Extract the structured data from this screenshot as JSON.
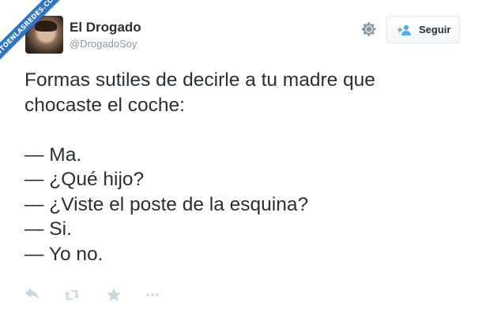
{
  "watermark": {
    "text": "VISTOENLASREDES.COM"
  },
  "author": {
    "name": "El Drogado",
    "handle": "@DrogadoSoy"
  },
  "follow_button": {
    "label": "Seguir"
  },
  "tweet": {
    "lines": [
      "Formas sutiles de decirle a tu madre que",
      "chocaste el coche:",
      "",
      "— Ma.",
      "— ¿Qué hijo?",
      "— ¿Viste el poste de la esquina?",
      "— Si.",
      "— Yo no."
    ]
  },
  "icons": {
    "settings": "gear-icon",
    "follow": "add-user-icon",
    "reply": "reply-icon",
    "retweet": "retweet-icon",
    "favorite": "star-icon",
    "more": "more-icon"
  },
  "colors": {
    "text": "#292f33",
    "muted": "#8899a6",
    "action_icons": "#ccd6dd",
    "follow_icon": "#55acee",
    "watermark_bg": "#2f74c6"
  }
}
